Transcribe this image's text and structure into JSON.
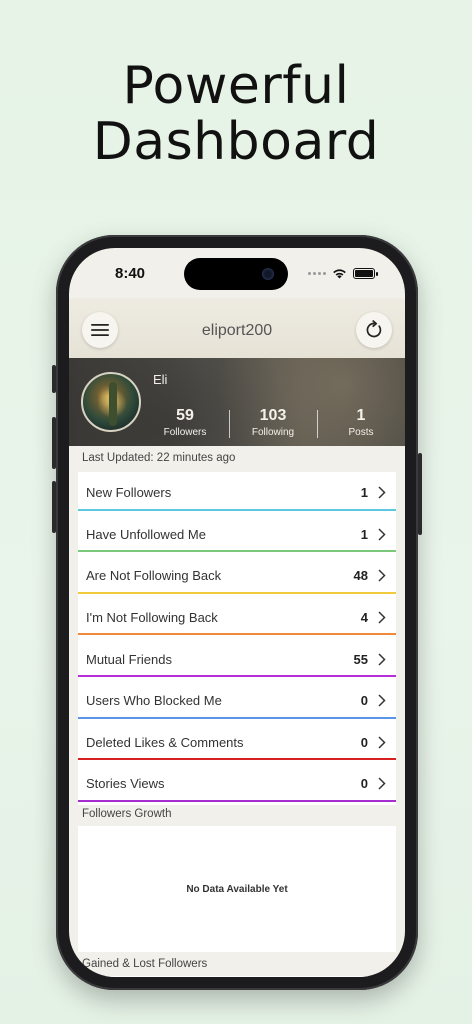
{
  "promo": {
    "headline_line1": "Powerful",
    "headline_line2": "Dashboard"
  },
  "status_bar": {
    "time": "8:40"
  },
  "nav": {
    "title": "eliport200",
    "menu_icon": "hamburger-icon",
    "refresh_icon": "refresh-icon"
  },
  "profile": {
    "name": "Eli",
    "stats": [
      {
        "value": "59",
        "label": "Followers"
      },
      {
        "value": "103",
        "label": "Following"
      },
      {
        "value": "1",
        "label": "Posts"
      }
    ]
  },
  "last_updated": "Last Updated: 22 minutes ago",
  "rows": [
    {
      "label": "New Followers",
      "count": "1",
      "color": "#5bc8e0"
    },
    {
      "label": "Have Unfollowed Me",
      "count": "1",
      "color": "#7cc87a"
    },
    {
      "label": "Are Not Following Back",
      "count": "48",
      "color": "#f0cc3a"
    },
    {
      "label": "I'm Not Following Back",
      "count": "4",
      "color": "#f08a3a"
    },
    {
      "label": "Mutual Friends",
      "count": "55",
      "color": "#b62ed8"
    },
    {
      "label": "Users Who Blocked Me",
      "count": "0",
      "color": "#5a94e6"
    },
    {
      "label": "Deleted Likes & Comments",
      "count": "0",
      "color": "#d81f1f"
    },
    {
      "label": "Stories Views",
      "count": "0",
      "color": "#a62ed0"
    }
  ],
  "followers_growth": {
    "title": "Followers Growth",
    "empty_message": "No Data Available Yet"
  },
  "gained_lost": {
    "title": "Gained & Lost Followers"
  }
}
